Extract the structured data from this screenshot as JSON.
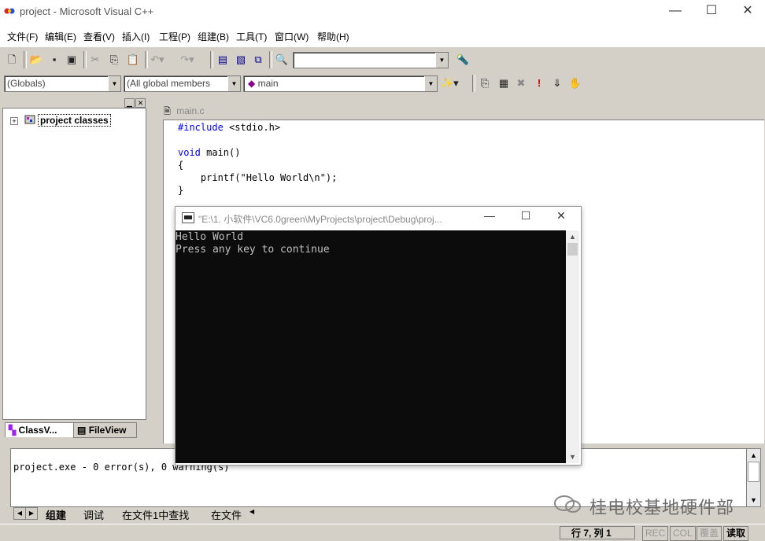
{
  "window": {
    "title": "project - Microsoft Visual C++",
    "controls": {
      "minimize": "—",
      "maximize": "☐",
      "close": "✕"
    }
  },
  "menu": [
    "文件(F)",
    "编辑(E)",
    "查看(V)",
    "插入(I)",
    "工程(P)",
    "组建(B)",
    "工具(T)",
    "窗口(W)",
    "帮助(H)"
  ],
  "toolbar2": {
    "globals": "(Globals)",
    "members": "(All global members",
    "function": "main"
  },
  "workspace": {
    "root": "project classes",
    "tabs": [
      "ClassV...",
      "FileView"
    ]
  },
  "editor": {
    "tab": "main.c",
    "lines": [
      {
        "kw": "#include",
        "rest": " <stdio.h>"
      },
      {
        "kw": "",
        "rest": ""
      },
      {
        "kw": "void",
        "rest": " main()"
      },
      {
        "kw": "",
        "rest": "{"
      },
      {
        "kw": "",
        "rest": "    printf(\"Hello World\\n\");"
      },
      {
        "kw": "",
        "rest": "}"
      }
    ]
  },
  "console": {
    "title": "\"E:\\1. 小软件\\VC6.0green\\MyProjects\\project\\Debug\\proj...",
    "lines": [
      "Hello World",
      "Press any key to continue"
    ]
  },
  "output": {
    "text": "project.exe - 0 error(s), 0 warning(s)",
    "tabs": [
      "组建",
      "调试",
      "在文件1中查找",
      "在文件"
    ]
  },
  "watermark": "桂电校基地硬件部",
  "status": {
    "position": "行 7, 列 1",
    "rec": "REC",
    "col": "COL",
    "ovr": "覆盖",
    "read": "读取"
  }
}
